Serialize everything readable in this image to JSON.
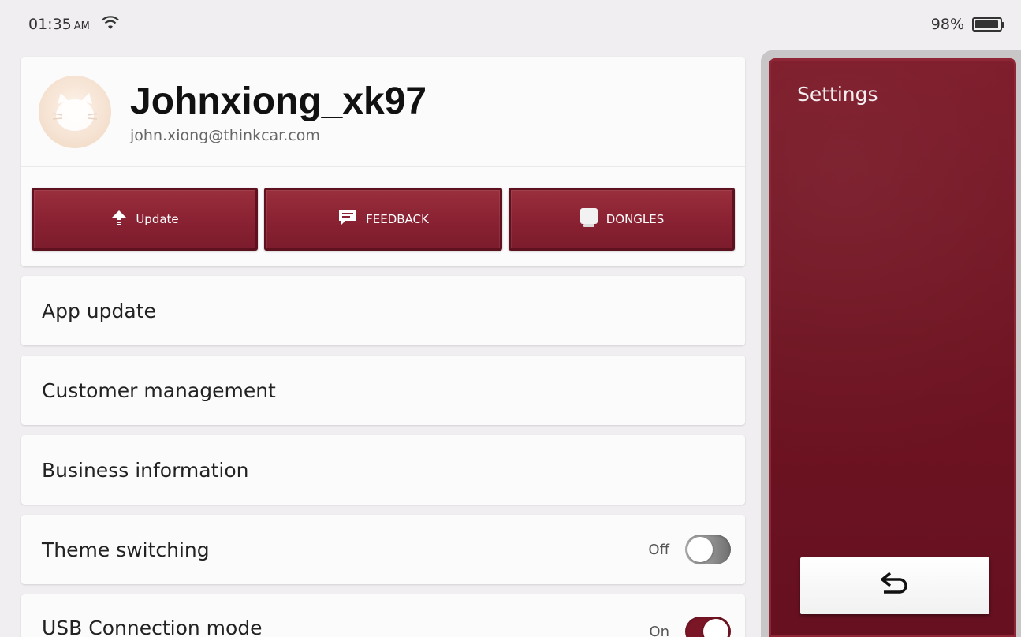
{
  "status": {
    "time": "01:35",
    "ampm": "AM",
    "battery": "98%",
    "battery_level": 0.98,
    "wifi_icon": "wifi-icon",
    "battery_icon": "battery-icon"
  },
  "profile": {
    "username": "Johnxiong_xk97",
    "email": "john.xiong@thinkcar.com"
  },
  "actions": {
    "update_label": "Update",
    "feedback_label": "FEEDBACK",
    "dongles_label": "DONGLES"
  },
  "menu": {
    "app_update": "App update",
    "customer_management": "Customer management",
    "business_information": "Business information",
    "theme_switching": "Theme switching",
    "theme_state": "Off",
    "usb_connection": "USB Connection mode",
    "usb_state": "On"
  },
  "sidebar": {
    "title": "Settings",
    "back_icon": "back-arrow-icon"
  },
  "colors": {
    "brand_red": "#7a1626",
    "background": "#f0eef0"
  }
}
